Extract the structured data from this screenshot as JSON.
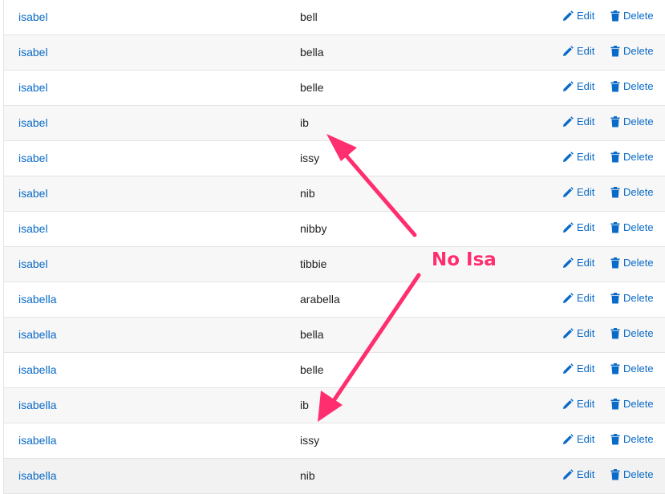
{
  "actions": {
    "edit_label": "Edit",
    "delete_label": "Delete",
    "edit_icon": "pencil-icon",
    "delete_icon": "trash-icon"
  },
  "rows": [
    {
      "name": "isabel",
      "nickname": "bell"
    },
    {
      "name": "isabel",
      "nickname": "bella"
    },
    {
      "name": "isabel",
      "nickname": "belle"
    },
    {
      "name": "isabel",
      "nickname": "ib"
    },
    {
      "name": "isabel",
      "nickname": "issy"
    },
    {
      "name": "isabel",
      "nickname": "nib"
    },
    {
      "name": "isabel",
      "nickname": "nibby"
    },
    {
      "name": "isabel",
      "nickname": "tibbie"
    },
    {
      "name": "isabella",
      "nickname": "arabella"
    },
    {
      "name": "isabella",
      "nickname": "bella"
    },
    {
      "name": "isabella",
      "nickname": "belle"
    },
    {
      "name": "isabella",
      "nickname": "ib"
    },
    {
      "name": "isabella",
      "nickname": "issy"
    },
    {
      "name": "isabella",
      "nickname": "nib"
    }
  ],
  "annotation": {
    "text": "No Isa",
    "color": "#ff2e6e"
  },
  "colors": {
    "link": "#0a6ac7",
    "stripe": "#f7f7f7"
  }
}
